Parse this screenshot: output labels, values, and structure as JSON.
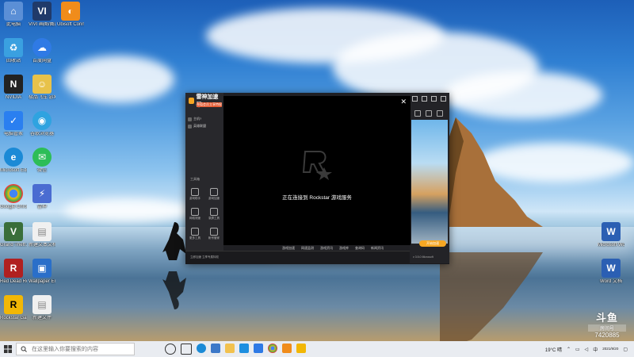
{
  "desktop": {
    "icons": [
      {
        "label": "此电脑",
        "color": "#5b8fd6"
      },
      {
        "label": "VIVI\n画图/图片处理",
        "color": "#203a6a"
      },
      {
        "label": "Ubisoft Connect",
        "color": "#f08c1b"
      },
      {
        "label": "回收站",
        "color": "#3aa0e0"
      },
      {
        "label": "百度网盘",
        "color": "#2f7ae5"
      },
      {
        "label": "NVIDIA",
        "color": "#222222"
      },
      {
        "label": "极品飞车 游戏助手",
        "color": "#e8c24a"
      },
      {
        "label": "电脑管家",
        "color": "#2a7ff0"
      },
      {
        "label": "谷歌浏览器",
        "color": "#2fa3e0"
      },
      {
        "label": "Microsoft Edge",
        "color": "#1b8ad6"
      },
      {
        "label": "微信",
        "color": "#2dbd57"
      },
      {
        "label": "Google Chrome",
        "color": "#e94335"
      },
      {
        "label": "雷神",
        "color": "#4a6cd1"
      },
      {
        "label": "Grand Theft Auto V",
        "color": "#3a6e3a"
      },
      {
        "label": "新建文本文档",
        "color": "#f0f0f0"
      },
      {
        "label": "Red Dead Redemption 2",
        "color": "#b02020"
      },
      {
        "label": "Wallpaper Engine",
        "color": "#2a6fc9"
      },
      {
        "label": "Rockstar Games Launcher",
        "color": "#f2b705"
      },
      {
        "label": "新建文件",
        "color": "#f0f0f0"
      },
      {
        "label": "Microsoft Word",
        "color": "#2b5fb3"
      },
      {
        "label": "Word 文档",
        "color": "#2b5fb3"
      }
    ]
  },
  "app": {
    "title": "雷神加速器",
    "promo": "充值会员立享特权",
    "games": [
      "主机?",
      "英雄联盟"
    ],
    "tools_label": "工具箱",
    "tools": [
      "游戏助手",
      "游戏加速",
      "网络测速",
      "录屏工具",
      "更多工具",
      "帐号管家"
    ],
    "bottom_tabs": [
      "游戏加速",
      "网速监测",
      "游戏资讯",
      "游戏库",
      "查询码",
      "新闻资讯"
    ],
    "bottom_note": "立即加速 立享专属特权",
    "start_button": "开始加速",
    "version": "v 3.5.0 Microsoft"
  },
  "game_dialog": {
    "message": "正在连接到 Rockstar 游戏服务",
    "close": "✕"
  },
  "taskbar": {
    "search_placeholder": "在这里输入你要搜索的内容",
    "weather": "19°C 晴",
    "time": "2021/9/20",
    "tray_label": "中"
  },
  "watermark": {
    "brand": "斗鱼",
    "sub": "房间号",
    "room": "7420885"
  }
}
